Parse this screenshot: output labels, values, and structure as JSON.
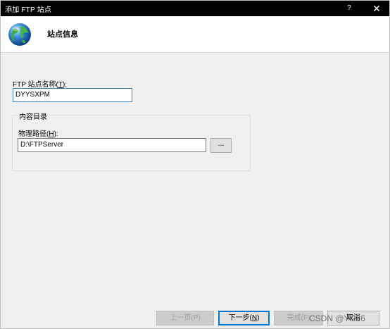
{
  "window": {
    "title": "添加 FTP 站点",
    "help_glyph": "?",
    "close_glyph": "✕"
  },
  "header": {
    "title": "站点信息",
    "icon": "globe-icon"
  },
  "site_name": {
    "label_prefix": "FTP 站点名称(",
    "label_hotkey": "T",
    "label_suffix": "):",
    "value": "DYYSXPM"
  },
  "content_dir": {
    "group_label": "内容目录",
    "path_label_prefix": "物理路径(",
    "path_label_hotkey": "H",
    "path_label_suffix": "):",
    "path_value": "D:\\FTPServer",
    "browse_label": "..."
  },
  "footer": {
    "prev_label": "上一页(P)",
    "next_label_prefix": "下一步(",
    "next_label_hotkey": "N",
    "next_label_suffix": ")",
    "finish_label": "完成(F)",
    "cancel_label": "取消"
  },
  "watermark": "CSDN @Yi226",
  "colors": {
    "titlebar": "#000000",
    "accent": "#0078d7"
  }
}
